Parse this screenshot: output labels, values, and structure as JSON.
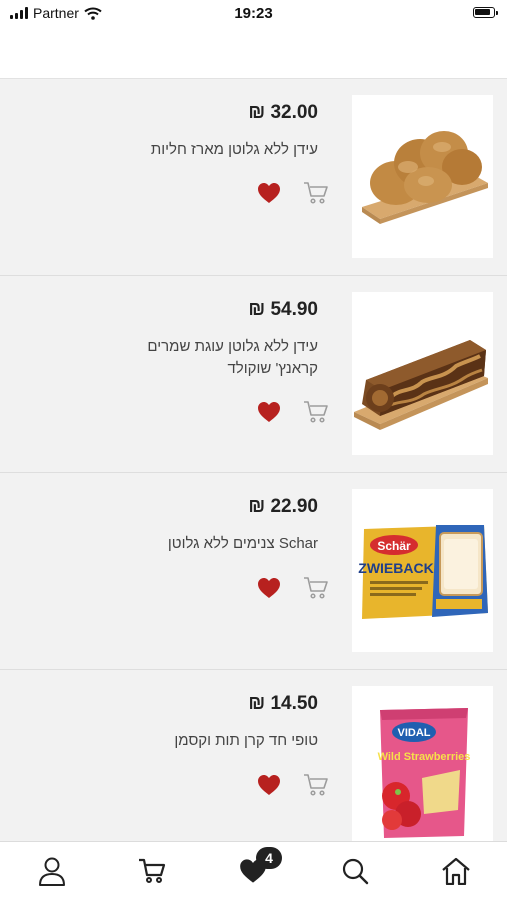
{
  "status_bar": {
    "carrier": "Partner",
    "time": "19:23"
  },
  "products": [
    {
      "price": "₪ 32.00",
      "name": "עידן ללא גלוטן מארז חליות",
      "favorite": true,
      "image": "challah-bread-on-board"
    },
    {
      "price": "₪ 54.90",
      "name": "עידן ללא גלוטן עוגת שמרים קראנץ' שוקולד",
      "favorite": true,
      "image": "chocolate-krantz-cake-on-board"
    },
    {
      "price": "₪ 22.90",
      "name": "Schar צנימים ללא גלוטן",
      "favorite": true,
      "image": "schar-zwieback-package",
      "package": {
        "brand": "Schär",
        "title": "ZWIEBACK"
      }
    },
    {
      "price": "₪ 14.50",
      "name": "טופי חד קרן תות וקסמן",
      "favorite": true,
      "image": "vidal-wild-strawberries-bag",
      "package": {
        "brand": "VIDAL",
        "title": "Wild Strawberries"
      }
    }
  ],
  "tabbar": {
    "favorites_badge": "4",
    "tabs": [
      "profile-icon",
      "cart-icon",
      "favorites-icon",
      "search-icon",
      "home-icon"
    ]
  },
  "colors": {
    "heart": "#b7211f",
    "background": "#f2f2f2",
    "badge": "#222222"
  }
}
